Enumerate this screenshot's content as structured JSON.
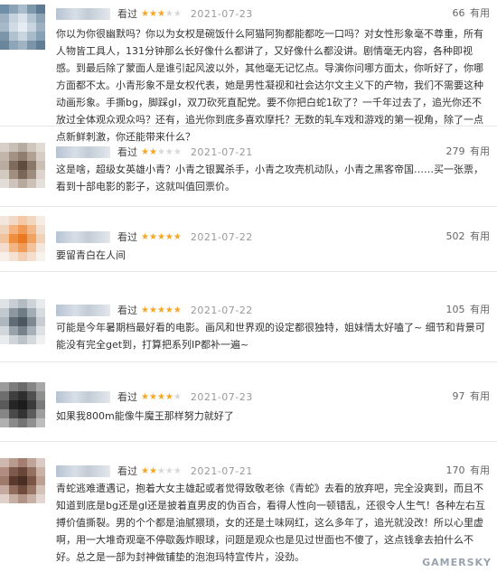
{
  "reviews": [
    {
      "seen": "看过",
      "rating": 3,
      "date": "2021-07-23",
      "useful_count": "66",
      "useful_label": "有用",
      "text": "你以为你很幽默吗？你以为女权是碗饭什么阿猫阿狗都能都吃一口吗？对女性形象毫不尊重，所有人物皆工具人，131分钟那么长好像什么都讲了，又好像什么都没讲。剧情毫无内容，各种即视感。到最后除了蒙面人是谁引起风波以外，其他毫无记忆点。导演你问哪方面太，你听好了，你哪方面都不太。小青形象不是女权代表，她是男性凝视和社会达尔文主义下的产物，我们不需要这种动画形象。手撕bg，脚踩gl，双刀砍死直配党。要不你把白蛇1砍了？一千年过去了，追光你还不放过全体观众观众吗？还有，追光你到底多喜欢摩托？无数的轧车戏和游戏的第一视角，除了一点点新鲜刺激，你还能带来什么？",
      "avatar": [
        "#6f8fa8",
        "#8aa3b6",
        "#a9bccb",
        "#7f97ab",
        "#5d7a92",
        "#9db1c2",
        "#c6d3dd",
        "#d9e2ea",
        "#b3c4d2",
        "#8da3b6",
        "#a6b9c8",
        "#d0dbe4",
        "#e6ecf1",
        "#c8d5df",
        "#9cb0c1",
        "#7d95a9",
        "#b0c2d0",
        "#c9d5df",
        "#a8bbca",
        "#86a0b4",
        "#6a869d",
        "#8fa6b8",
        "#9fb3c3",
        "#7b94a8",
        "#617d95"
      ]
    },
    {
      "seen": "看过",
      "rating": 2,
      "date": "2021-07-21",
      "useful_count": "279",
      "useful_label": "有用",
      "text": "这是啥，超级女英雄小青？小青之银翼杀手，小青之攻壳机动队，小青之黑客帝国……买一张票，看到十部电影的影子，这就叫值回票价。",
      "avatar": [
        "#d8d0c8",
        "#c9bfb6",
        "#b8aca2",
        "#cfc6bd",
        "#e2dbd4",
        "#c2b6ab",
        "#a39283",
        "#8f7d6e",
        "#b0a193",
        "#d6cdc5",
        "#b9ab9f",
        "#7e6b5c",
        "#5e4c3f",
        "#8a7767",
        "#cbbfb4",
        "#d3cac1",
        "#a08f80",
        "#7a6757",
        "#9e8c7d",
        "#dcd4cd",
        "#e4ddd7",
        "#cec4bb",
        "#b6a99d",
        "#cbc1b7",
        "#e6e0da"
      ]
    },
    {
      "seen": "看过",
      "rating": 5,
      "date": "2021-07-22",
      "useful_count": "502",
      "useful_label": "有用",
      "text": "要留青白在人间",
      "avatar": [
        "#f3e6dc",
        "#f0d9c6",
        "#f5c9a6",
        "#f2d7c0",
        "#f6ece4",
        "#eed3bd",
        "#f4b27f",
        "#f19a56",
        "#f3b88a",
        "#f1dfd0",
        "#f0c39d",
        "#ee8e3f",
        "#e97a23",
        "#f0a263",
        "#f2d2b6",
        "#f3dccb",
        "#f2b585",
        "#f09b57",
        "#f3c29b",
        "#f5e7dc",
        "#f7efe9",
        "#f4e1d2",
        "#f2cfb2",
        "#f4dfcf",
        "#f8f2ed"
      ]
    },
    {
      "seen": "看过",
      "rating": 5,
      "date": "2021-07-22",
      "useful_count": "105",
      "useful_label": "有用",
      "text": "可能是今年暑期档最好看的电影。画风和世界观的设定都很独特，姐妹情太好嗑了~ 细节和背景可能没有完全get到，打算把系列IP都补一遍~",
      "avatar": [
        "#dfe3e6",
        "#c8ced3",
        "#b4bcc3",
        "#cdd3d8",
        "#e8ebed",
        "#c1c8ce",
        "#8c979f",
        "#6f7b85",
        "#a3adb5",
        "#d6dbdf",
        "#aeb7be",
        "#5f6b75",
        "#4b5660",
        "#7d8891",
        "#c7cdd2",
        "#d2d7db",
        "#98a2aa",
        "#76828b",
        "#a7b0b8",
        "#dde1e4",
        "#e9ecee",
        "#d0d5d9",
        "#bcc3c9",
        "#d4d9dd",
        "#eef0f2"
      ]
    },
    {
      "seen": "看过",
      "rating": 4,
      "date": "2021-07-23",
      "useful_count": "97",
      "useful_label": "有用",
      "text": "如果我800m能像牛魔王那样努力就好了",
      "avatar": [
        "#9a9a9a",
        "#7c7c7c",
        "#6a6a6a",
        "#858585",
        "#a8a8a8",
        "#6e6e6e",
        "#3f3f3f",
        "#2f2f2f",
        "#505050",
        "#8e8e8e",
        "#5a5a5a",
        "#262626",
        "#1c1c1c",
        "#3a3a3a",
        "#7a7a7a",
        "#868686",
        "#4a4a4a",
        "#333333",
        "#5c5c5c",
        "#9e9e9e",
        "#b0b0b0",
        "#8a8a8a",
        "#747474",
        "#909090",
        "#bdbdbd"
      ]
    },
    {
      "seen": "看过",
      "rating": 2,
      "date": "2021-07-21",
      "useful_count": "170",
      "useful_label": "有用",
      "text": "青蛇逃难遭遇记，抱着大女主雄起或者觉得致敬老徐《青蛇》去看的放弃吧，完全没爽到，而且不知道到底是bg还是gl还是披着直男皮的伪百合，看得人性向一顿错乱，还很令人生气！各种左右互搏价值撕裂。男的个个都是油腻猥琐，女的还是土味网红，这么多年了，追光就没改！所以心里虚啊，用一大堆奇观毫不停歇轰炸眼球，问题是观众也是见过世面也不傻了，这点钱拿去拍什么不好。总之是一部为封神做铺垫的泡泡玛特宣传片，没劲。",
      "avatar": [
        "#cdb7ae",
        "#b89a8e",
        "#a47f71",
        "#c0a497",
        "#dccbc4",
        "#b08d80",
        "#7e5a4d",
        "#6a4639",
        "#93705f",
        "#cbb2a7",
        "#9f7a6b",
        "#5a3a2e",
        "#4a2d23",
        "#7a5546",
        "#bea193",
        "#c4aa9e",
        "#8e6b5b",
        "#6e4b3d",
        "#987565",
        "#d4c1b8",
        "#dfd0c9",
        "#c5aea3",
        "#b29487",
        "#c8b0a5",
        "#e4d7d1"
      ]
    }
  ],
  "watermark": "GAMERSKY"
}
